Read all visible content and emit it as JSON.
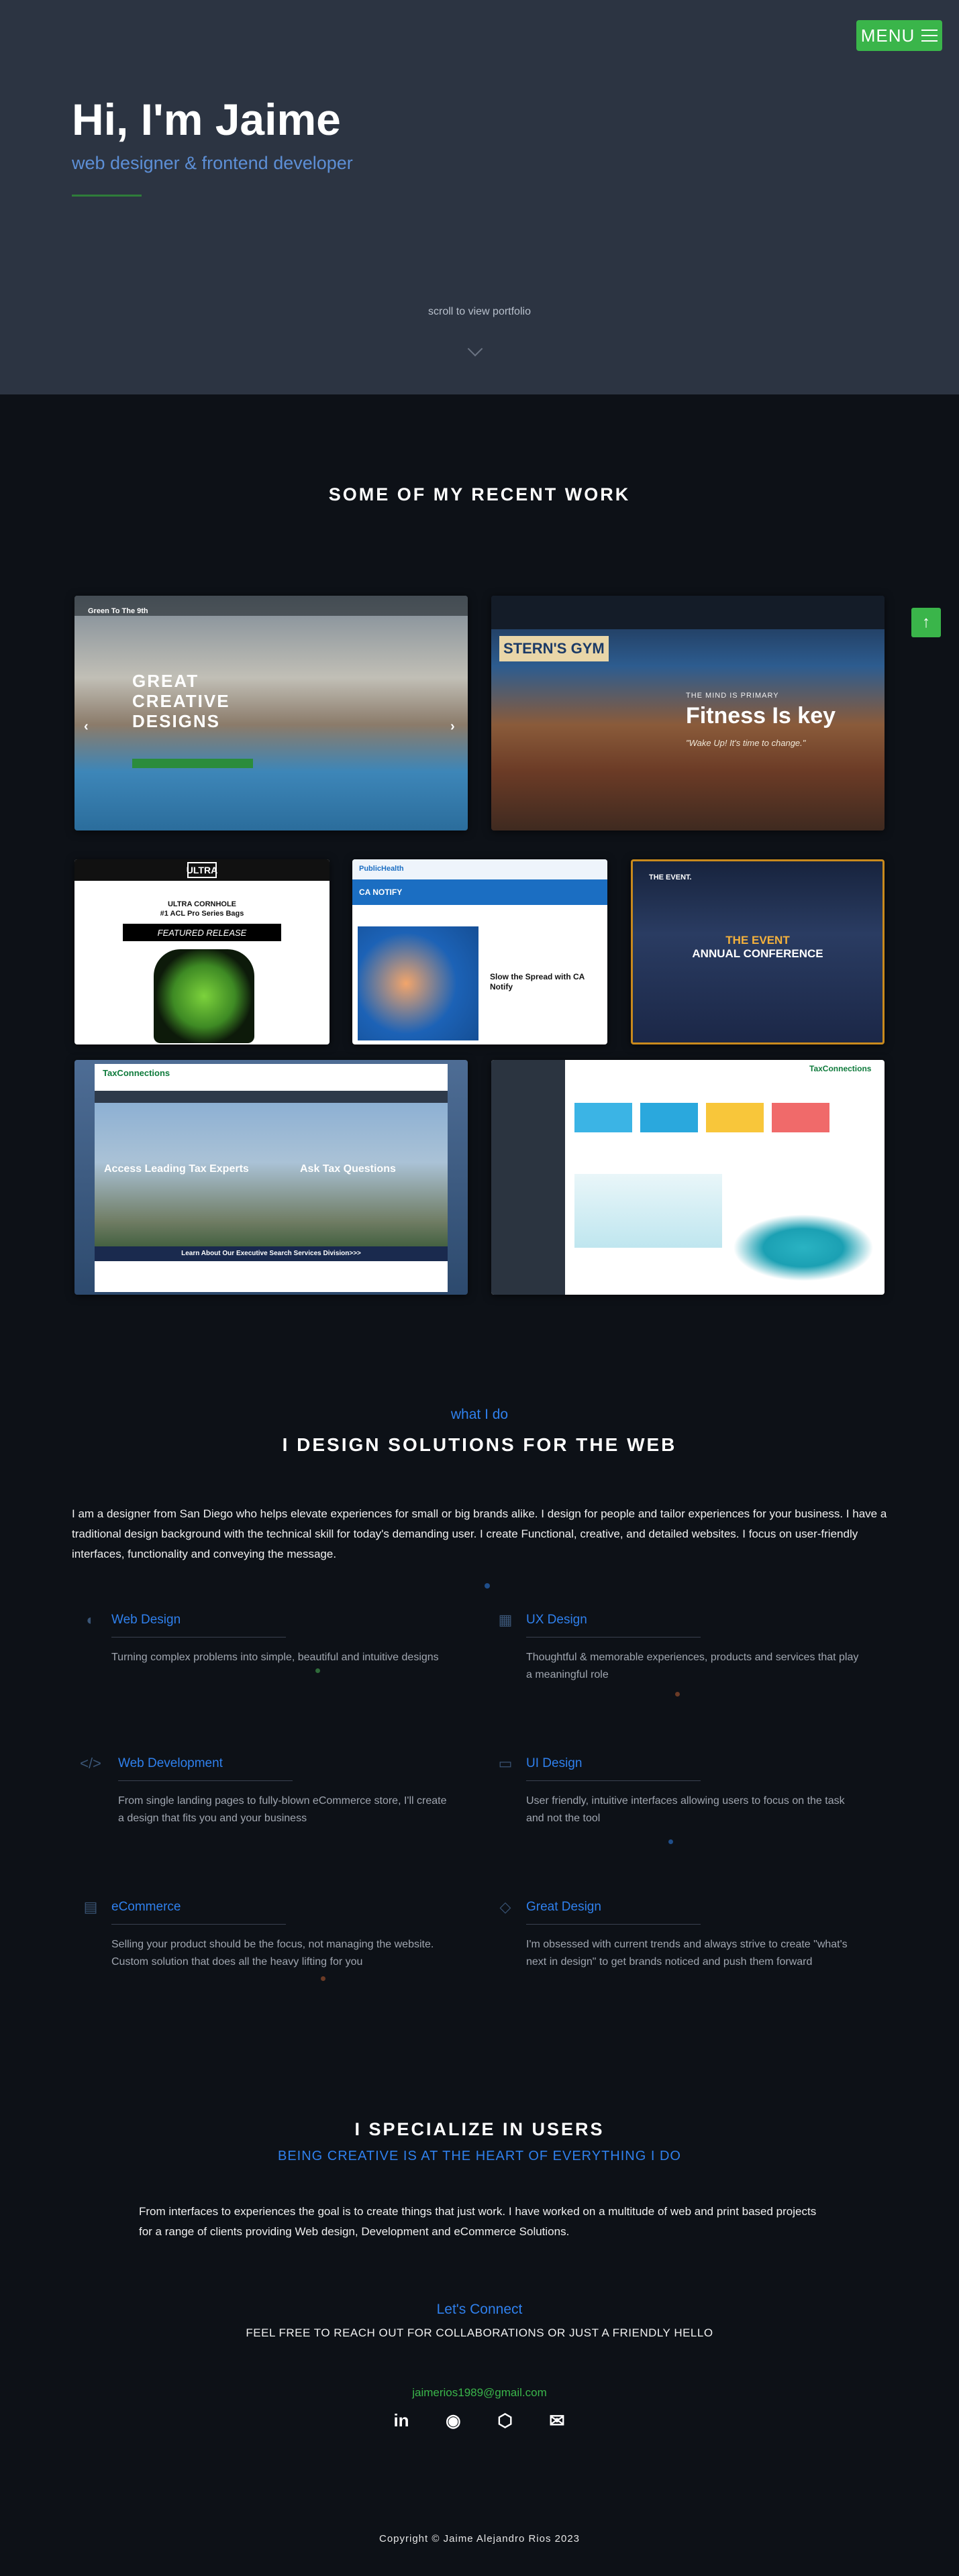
{
  "nav": {
    "menu_label": "MENU",
    "menu_icon": "hamburger-icon"
  },
  "hero": {
    "title": "Hi, I'm Jaime",
    "subtitle": "web designer & frontend developer",
    "scroll_text": "scroll to view portfolio",
    "scroll_icon": "chevron-down-icon"
  },
  "works": {
    "title": "SOME OF MY RECENT WORK",
    "scroll_top_icon": "arrow-up-icon",
    "items": [
      {
        "caption": "GREAT CREATIVE DESIGNS",
        "brand": "Green To The 9th"
      },
      {
        "caption": "Fitness Is key",
        "kicker": "THE MIND IS PRIMARY",
        "sub": "\"Wake Up! It's time to change.\"",
        "brand": "STERN'S GYM"
      },
      {
        "logo": "ULTRA",
        "line1": "ULTRA CORNHOLE",
        "line2": "#1 ACL Pro Series Bags",
        "badge": "FEATURED RELEASE"
      },
      {
        "banner": "CA NOTIFY",
        "heading": "Slow the Spread with CA Notify",
        "brand": "PublicHealth"
      },
      {
        "brand": "THE EVENT.",
        "line1": "THE EVENT",
        "line2": "ANNUAL CONFERENCE"
      },
      {
        "brand": "TaxConnections",
        "left": "Access Leading Tax Experts",
        "right": "Ask Tax Questions",
        "strip": "Learn About Our Executive Search Services Division>>>"
      },
      {
        "brand": "TaxConnections"
      }
    ]
  },
  "what_i_do": {
    "kicker": "what I do",
    "title": "I DESIGN SOLUTIONS FOR THE WEB",
    "paragraph": "I am a designer from San Diego who helps elevate experiences for small or big brands alike. I design for people and tailor experiences for your business. I have a traditional design background with the technical skill for today's demanding user. I create Functional, creative, and detailed websites. I focus on user-friendly interfaces, functionality and conveying the message.",
    "services": [
      {
        "icon": "palette-icon",
        "title": "Web Design",
        "desc": "Turning complex problems into simple, beautiful and intuitive designs"
      },
      {
        "icon": "cubes-icon",
        "title": "UX Design",
        "desc": "Thoughtful & memorable experiences, products and services that play a meaningful role"
      },
      {
        "icon": "code-icon",
        "title": "Web Development",
        "desc": "From single landing pages to fully-blown eCommerce store, I'll create a design that fits you and your business"
      },
      {
        "icon": "monitor-icon",
        "title": "UI Design",
        "desc": "User friendly, intuitive interfaces allowing users to focus on the task and not the tool"
      },
      {
        "icon": "document-icon",
        "title": "eCommerce",
        "desc": "Selling your product should be the focus, not managing the website. Custom solution that does all the heavy lifting for you"
      },
      {
        "icon": "diamond-icon",
        "title": "Great Design",
        "desc": "I'm obsessed with current trends and always strive to create \"what's next in design\" to get brands noticed and push them forward"
      }
    ]
  },
  "specialize": {
    "title": "I SPECIALIZE IN USERS",
    "subtitle": "BEING CREATIVE IS AT THE HEART OF EVERYTHING I DO",
    "paragraph": "From interfaces to experiences the goal is to create things that just work. I have worked on a multitude of web and print based projects for a range of clients providing Web design, Development and eCommerce Solutions.",
    "contact_kicker": "Let's Connect",
    "contact_line": "FEEL FREE TO REACH OUT FOR COLLABORATIONS OR JUST A FRIENDLY HELLO",
    "email": "jaimerios1989@gmail.com",
    "socials": [
      {
        "icon": "linkedin-icon",
        "glyph": "in"
      },
      {
        "icon": "github-icon",
        "glyph": "◉"
      },
      {
        "icon": "codepen-icon",
        "glyph": "⬡"
      },
      {
        "icon": "envelope-icon",
        "glyph": "✉"
      }
    ]
  },
  "footer": {
    "copyright": "Copyright © Jaime Alejandro Rios 2023"
  },
  "colors": {
    "accent_green": "#3ab54a",
    "accent_blue": "#2f80ed",
    "hero_bg": "#2c3442",
    "page_bg": "#0d1117"
  }
}
